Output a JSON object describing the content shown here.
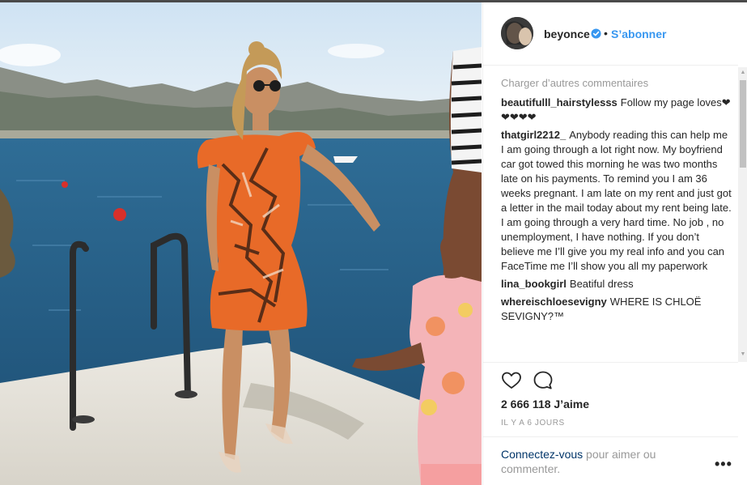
{
  "post": {
    "username": "beyonce",
    "follow_label": "S’abonner",
    "separator": "•",
    "load_more": "Charger d’autres commentaires",
    "comments": [
      {
        "user": "beautifulll_hairstylesss",
        "text": "Follow my page loves❤❤❤❤❤"
      },
      {
        "user": "thatgirl2212_",
        "text": "Anybody reading this can help me I am going through a lot right now. My boyfriend car got towed this morning he was two months late on his payments. To remind you I am 36 weeks pregnant. I am late on my rent and just got a letter in the mail today about my rent being late. I am going through a very hard time. No job , no unemployment, I have nothing. If you don’t believe me I’ll give you my real info and you can FaceTime me I’ll show you all my paperwork"
      },
      {
        "user": "lina_bookgirl",
        "text": "Beatiful dress"
      },
      {
        "user": "whereischloesevigny",
        "text": "WHERE IS CHLOË SEVIGNY?™"
      }
    ],
    "likes": "2 666 118 J’aime",
    "time": "IL Y A 6 JOURS",
    "login_link": "Connectez-vous",
    "login_rest": " pour aimer ou commenter.",
    "more_label": "•••"
  },
  "icons": {
    "like": "heart-icon",
    "comment": "comment-bubble-icon",
    "verified": "verified-badge-icon",
    "more": "more-options-icon"
  },
  "colors": {
    "link_blue": "#3897f0",
    "text": "#262626",
    "muted": "#999999",
    "login_link": "#003569"
  }
}
